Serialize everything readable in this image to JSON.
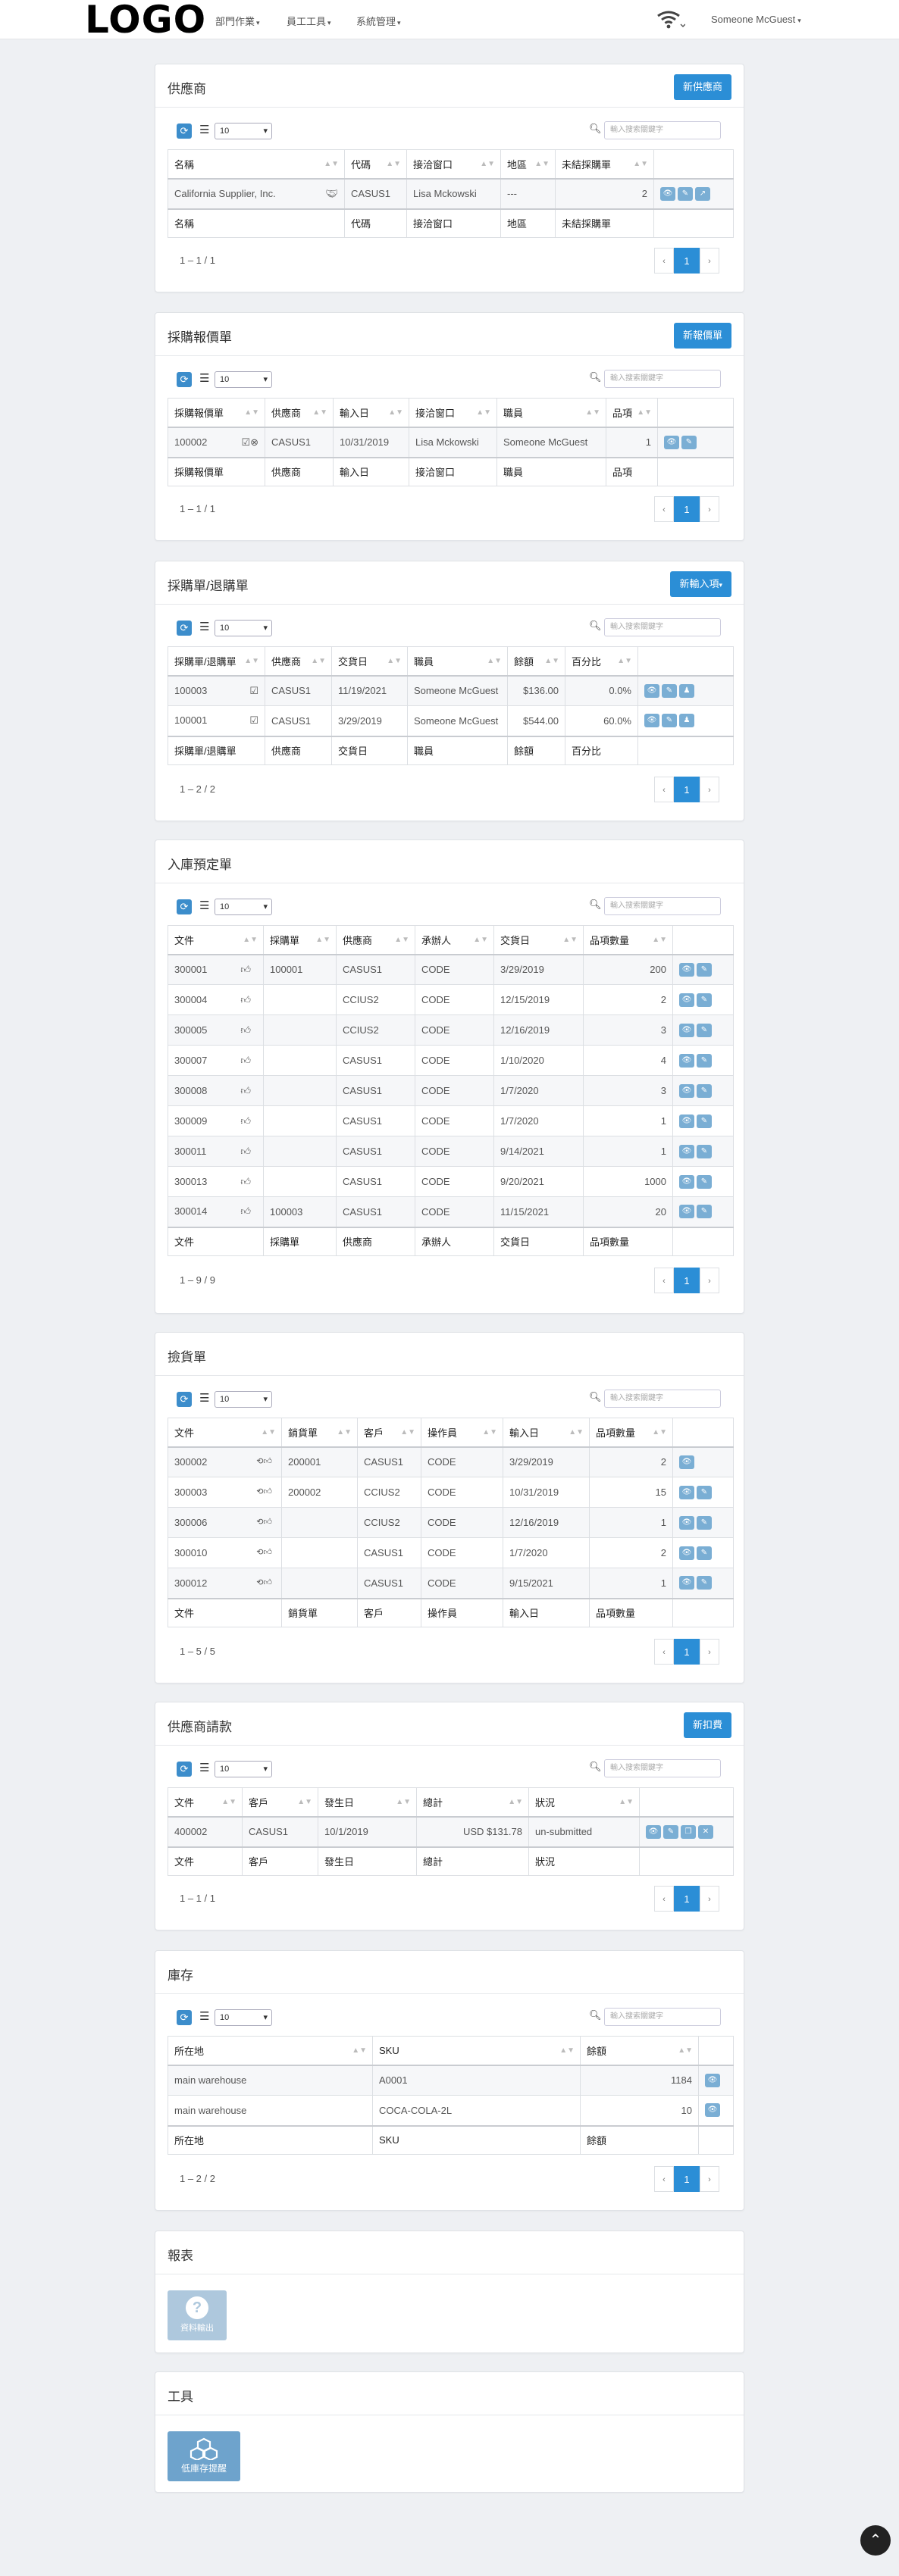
{
  "nav": {
    "logo": "LOGO",
    "menu1": "部門作業",
    "menu2": "員工工具",
    "menu3": "系統管理",
    "user": "Someone McGuest"
  },
  "common": {
    "page_size": "10",
    "search_placeholder": "輸入搜索關鍵字"
  },
  "suppliers": {
    "title": "供應商",
    "button": "新供應商",
    "columns": [
      "名稱",
      "代碼",
      "接洽窗口",
      "地區",
      "未結採購單"
    ],
    "rows": [
      {
        "name": "California Supplier, Inc.",
        "code": "CASUS1",
        "contact": "Lisa Mckowski",
        "region": "---",
        "open": "2"
      }
    ],
    "pager_info": "1 – 1 / 1",
    "page": "1"
  },
  "quotes": {
    "title": "採購報價單",
    "button": "新報價單",
    "columns": [
      "採購報價單",
      "供應商",
      "輸入日",
      "接洽窗口",
      "職員",
      "品項"
    ],
    "rows": [
      {
        "doc": "100002",
        "supplier": "CASUS1",
        "date": "10/31/2019",
        "contact": "Lisa Mckowski",
        "staff": "Someone McGuest",
        "items": "1"
      }
    ],
    "pager_info": "1 – 1 / 1",
    "page": "1"
  },
  "orders": {
    "title": "採購單/退購單",
    "button": "新輸入項",
    "columns": [
      "採購單/退購單",
      "供應商",
      "交貨日",
      "職員",
      "餘額",
      "百分比"
    ],
    "rows": [
      {
        "doc": "100003",
        "supplier": "CASUS1",
        "date": "11/19/2021",
        "staff": "Someone McGuest",
        "amount": "$136.00",
        "pct": "0.0%"
      },
      {
        "doc": "100001",
        "supplier": "CASUS1",
        "date": "3/29/2019",
        "staff": "Someone McGuest",
        "amount": "$544.00",
        "pct": "60.0%"
      }
    ],
    "pager_info": "1 – 2 / 2",
    "page": "1"
  },
  "receipts": {
    "title": "入庫預定單",
    "columns": [
      "文件",
      "採購單",
      "供應商",
      "承辦人",
      "交貨日",
      "品項數量"
    ],
    "rows": [
      {
        "doc": "300001",
        "po": "100001",
        "supplier": "CASUS1",
        "handler": "CODE",
        "date": "3/29/2019",
        "qty": "200"
      },
      {
        "doc": "300004",
        "po": "",
        "supplier": "CCIUS2",
        "handler": "CODE",
        "date": "12/15/2019",
        "qty": "2"
      },
      {
        "doc": "300005",
        "po": "",
        "supplier": "CCIUS2",
        "handler": "CODE",
        "date": "12/16/2019",
        "qty": "3"
      },
      {
        "doc": "300007",
        "po": "",
        "supplier": "CASUS1",
        "handler": "CODE",
        "date": "1/10/2020",
        "qty": "4"
      },
      {
        "doc": "300008",
        "po": "",
        "supplier": "CASUS1",
        "handler": "CODE",
        "date": "1/7/2020",
        "qty": "3"
      },
      {
        "doc": "300009",
        "po": "",
        "supplier": "CASUS1",
        "handler": "CODE",
        "date": "1/7/2020",
        "qty": "1"
      },
      {
        "doc": "300011",
        "po": "",
        "supplier": "CASUS1",
        "handler": "CODE",
        "date": "9/14/2021",
        "qty": "1"
      },
      {
        "doc": "300013",
        "po": "",
        "supplier": "CASUS1",
        "handler": "CODE",
        "date": "9/20/2021",
        "qty": "1000"
      },
      {
        "doc": "300014",
        "po": "100003",
        "supplier": "CASUS1",
        "handler": "CODE",
        "date": "11/15/2021",
        "qty": "20"
      }
    ],
    "pager_info": "1 – 9 / 9",
    "page": "1"
  },
  "picking": {
    "title": "撿貨單",
    "columns": [
      "文件",
      "銷貨單",
      "客戶",
      "操作員",
      "輸入日",
      "品項數量"
    ],
    "rows": [
      {
        "doc": "300002",
        "so": "200001",
        "customer": "CASUS1",
        "operator": "CODE",
        "date": "3/29/2019",
        "qty": "2"
      },
      {
        "doc": "300003",
        "so": "200002",
        "customer": "CCIUS2",
        "operator": "CODE",
        "date": "10/31/2019",
        "qty": "15"
      },
      {
        "doc": "300006",
        "so": "",
        "customer": "CCIUS2",
        "operator": "CODE",
        "date": "12/16/2019",
        "qty": "1"
      },
      {
        "doc": "300010",
        "so": "",
        "customer": "CASUS1",
        "operator": "CODE",
        "date": "1/7/2020",
        "qty": "2"
      },
      {
        "doc": "300012",
        "so": "",
        "customer": "CASUS1",
        "operator": "CODE",
        "date": "9/15/2021",
        "qty": "1"
      }
    ],
    "pager_info": "1 – 5 / 5",
    "page": "1"
  },
  "invoices": {
    "title": "供應商請款",
    "button": "新扣費",
    "columns": [
      "文件",
      "客戶",
      "發生日",
      "總計",
      "狀況"
    ],
    "rows": [
      {
        "doc": "400002",
        "customer": "CASUS1",
        "date": "10/1/2019",
        "total": "USD $131.78",
        "status": "un-submitted"
      }
    ],
    "pager_info": "1 – 1 / 1",
    "page": "1"
  },
  "inventory": {
    "title": "庫存",
    "columns": [
      "所在地",
      "SKU",
      "餘額"
    ],
    "rows": [
      {
        "location": "main warehouse",
        "sku": "A0001",
        "qty": "1184"
      },
      {
        "location": "main warehouse",
        "sku": "COCA-COLA-2L",
        "qty": "10"
      }
    ],
    "pager_info": "1 – 2 / 2",
    "page": "1"
  },
  "reports": {
    "title": "報表",
    "tile": "資料輸出"
  },
  "tools": {
    "title": "工具",
    "tile": "低庫存提醒"
  }
}
